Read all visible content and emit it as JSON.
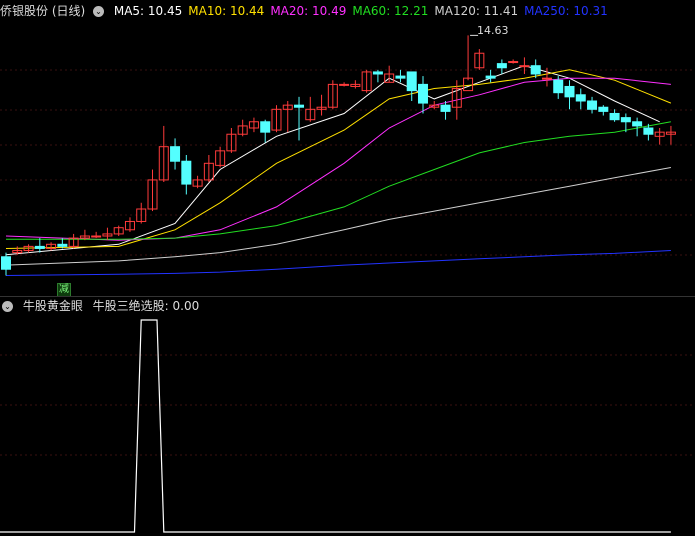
{
  "main": {
    "title": "侨银股份 (日线)",
    "ma_labels": [
      {
        "text": "MA5: 10.45",
        "color": "#ffffff"
      },
      {
        "text": "MA10: 10.44",
        "color": "#ffe000"
      },
      {
        "text": "MA20: 10.49",
        "color": "#ff30ff"
      },
      {
        "text": "MA60: 12.21",
        "color": "#22dd22"
      },
      {
        "text": "MA120: 11.41",
        "color": "#cfcfcf"
      },
      {
        "text": "MA250: 10.31",
        "color": "#2233ff"
      }
    ],
    "high_label": "14.63",
    "badge": "减"
  },
  "sub": {
    "title": "牛股黄金眼",
    "value_label": "牛股三绝选股: 0.00"
  },
  "colors": {
    "up": "#ff3b3b",
    "down": "#54ffff",
    "bg": "#000000",
    "grid": "#3a1010"
  },
  "chart_data": {
    "type": "candlestick",
    "ylim": [
      8.5,
      15.0
    ],
    "candles": [
      [
        9.3,
        9.4,
        9.0,
        8.85
      ],
      [
        9.4,
        9.55,
        9.45,
        9.35
      ],
      [
        9.45,
        9.6,
        9.55,
        9.4
      ],
      [
        9.55,
        9.75,
        9.5,
        9.4
      ],
      [
        9.5,
        9.65,
        9.6,
        9.45
      ],
      [
        9.6,
        9.75,
        9.55,
        9.5
      ],
      [
        9.55,
        9.85,
        9.75,
        9.5
      ],
      [
        9.75,
        9.95,
        9.8,
        9.7
      ],
      [
        9.8,
        9.9,
        9.8,
        9.75
      ],
      [
        9.8,
        10.0,
        9.85,
        9.7
      ],
      [
        9.85,
        10.05,
        10.0,
        9.8
      ],
      [
        9.95,
        10.25,
        10.15,
        9.9
      ],
      [
        10.15,
        10.6,
        10.45,
        10.1
      ],
      [
        10.45,
        11.4,
        11.15,
        10.4
      ],
      [
        11.15,
        12.45,
        11.95,
        11.1
      ],
      [
        11.95,
        12.15,
        11.6,
        11.4
      ],
      [
        11.6,
        11.75,
        11.05,
        10.8
      ],
      [
        11.0,
        11.25,
        11.15,
        10.95
      ],
      [
        11.15,
        11.75,
        11.55,
        11.1
      ],
      [
        11.5,
        11.95,
        11.85,
        11.45
      ],
      [
        11.85,
        12.4,
        12.25,
        11.8
      ],
      [
        12.25,
        12.6,
        12.45,
        12.2
      ],
      [
        12.4,
        12.65,
        12.55,
        12.3
      ],
      [
        12.55,
        12.6,
        12.3,
        12.05
      ],
      [
        12.35,
        12.95,
        12.85,
        12.3
      ],
      [
        12.85,
        13.05,
        12.95,
        12.3
      ],
      [
        12.95,
        13.15,
        12.9,
        12.1
      ],
      [
        12.6,
        13.15,
        12.85,
        12.55
      ],
      [
        12.85,
        13.2,
        12.9,
        12.7
      ],
      [
        12.9,
        13.55,
        13.45,
        12.85
      ],
      [
        13.45,
        13.5,
        13.45,
        13.4
      ],
      [
        13.4,
        13.55,
        13.45,
        13.35
      ],
      [
        13.3,
        13.8,
        13.75,
        13.25
      ],
      [
        13.75,
        13.8,
        13.7,
        13.5
      ],
      [
        13.5,
        13.9,
        13.7,
        13.5
      ],
      [
        13.65,
        13.8,
        13.6,
        13.5
      ],
      [
        13.75,
        13.75,
        13.3,
        13.05
      ],
      [
        13.45,
        13.65,
        13.0,
        12.75
      ],
      [
        12.9,
        13.05,
        12.95,
        12.85
      ],
      [
        12.95,
        13.05,
        12.8,
        12.6
      ],
      [
        12.9,
        13.55,
        13.35,
        12.6
      ],
      [
        13.3,
        14.63,
        13.6,
        13.55
      ],
      [
        13.85,
        14.3,
        14.2,
        13.8
      ],
      [
        13.65,
        13.8,
        13.6,
        13.5
      ],
      [
        13.95,
        14.05,
        13.85,
        13.7
      ],
      [
        14.0,
        14.05,
        14.0,
        13.95
      ],
      [
        13.9,
        14.1,
        13.9,
        13.7
      ],
      [
        13.9,
        14.05,
        13.7,
        13.6
      ],
      [
        13.6,
        13.85,
        13.6,
        13.4
      ],
      [
        13.55,
        13.65,
        13.25,
        13.1
      ],
      [
        13.4,
        13.55,
        13.15,
        12.85
      ],
      [
        13.2,
        13.35,
        13.05,
        12.85
      ],
      [
        13.05,
        13.15,
        12.85,
        12.75
      ],
      [
        12.9,
        12.95,
        12.8,
        12.7
      ],
      [
        12.75,
        12.85,
        12.6,
        12.55
      ],
      [
        12.65,
        12.75,
        12.55,
        12.3
      ],
      [
        12.55,
        12.65,
        12.45,
        12.2
      ],
      [
        12.4,
        12.5,
        12.25,
        12.1
      ],
      [
        12.2,
        12.4,
        12.3,
        12.0
      ],
      [
        12.25,
        12.45,
        12.3,
        12.0
      ]
    ],
    "ma_series": [
      {
        "name": "MA5",
        "values": [
          [
            0,
            9.35
          ],
          [
            10,
            9.6
          ],
          [
            15,
            10.1
          ],
          [
            19,
            11.4
          ],
          [
            24,
            12.2
          ],
          [
            30,
            12.75
          ],
          [
            34,
            13.6
          ],
          [
            38,
            13.1
          ],
          [
            42,
            13.5
          ],
          [
            46,
            13.9
          ],
          [
            50,
            13.6
          ],
          [
            54,
            13.05
          ],
          [
            58,
            12.55
          ]
        ]
      },
      {
        "name": "MA10",
        "values": [
          [
            0,
            9.5
          ],
          [
            10,
            9.55
          ],
          [
            15,
            9.95
          ],
          [
            19,
            10.6
          ],
          [
            24,
            11.55
          ],
          [
            30,
            12.35
          ],
          [
            34,
            13.1
          ],
          [
            38,
            13.35
          ],
          [
            42,
            13.45
          ],
          [
            46,
            13.6
          ],
          [
            50,
            13.8
          ],
          [
            54,
            13.55
          ],
          [
            59,
            13.0
          ]
        ]
      },
      {
        "name": "MA20",
        "values": [
          [
            0,
            9.8
          ],
          [
            10,
            9.7
          ],
          [
            15,
            9.75
          ],
          [
            19,
            9.95
          ],
          [
            24,
            10.5
          ],
          [
            30,
            11.55
          ],
          [
            34,
            12.4
          ],
          [
            38,
            12.95
          ],
          [
            42,
            13.2
          ],
          [
            46,
            13.5
          ],
          [
            50,
            13.6
          ],
          [
            54,
            13.6
          ],
          [
            59,
            13.45
          ]
        ]
      },
      {
        "name": "MA60",
        "values": [
          [
            0,
            9.72
          ],
          [
            10,
            9.72
          ],
          [
            15,
            9.75
          ],
          [
            19,
            9.85
          ],
          [
            24,
            10.05
          ],
          [
            30,
            10.5
          ],
          [
            34,
            11.0
          ],
          [
            38,
            11.4
          ],
          [
            42,
            11.8
          ],
          [
            46,
            12.05
          ],
          [
            50,
            12.2
          ],
          [
            54,
            12.3
          ],
          [
            59,
            12.55
          ]
        ]
      },
      {
        "name": "MA120",
        "values": [
          [
            0,
            9.1
          ],
          [
            10,
            9.2
          ],
          [
            15,
            9.3
          ],
          [
            19,
            9.4
          ],
          [
            24,
            9.6
          ],
          [
            30,
            9.95
          ],
          [
            34,
            10.2
          ],
          [
            38,
            10.4
          ],
          [
            42,
            10.6
          ],
          [
            46,
            10.8
          ],
          [
            50,
            11.0
          ],
          [
            54,
            11.2
          ],
          [
            59,
            11.45
          ]
        ]
      },
      {
        "name": "MA250",
        "values": [
          [
            0,
            8.85
          ],
          [
            10,
            8.88
          ],
          [
            15,
            8.9
          ],
          [
            19,
            8.93
          ],
          [
            24,
            9.0
          ],
          [
            30,
            9.1
          ],
          [
            34,
            9.15
          ],
          [
            38,
            9.2
          ],
          [
            42,
            9.25
          ],
          [
            46,
            9.3
          ],
          [
            50,
            9.35
          ],
          [
            54,
            9.38
          ],
          [
            59,
            9.45
          ]
        ]
      }
    ],
    "indicator": {
      "name": "牛股三绝选股",
      "ylim": [
        0,
        1
      ],
      "values": [
        0,
        0,
        0,
        0,
        0,
        0,
        0,
        0,
        0,
        0,
        0,
        0,
        1,
        1,
        0,
        0,
        0,
        0,
        0,
        0,
        0,
        0,
        0,
        0,
        0,
        0,
        0,
        0,
        0,
        0,
        0,
        0,
        0,
        0,
        0,
        0,
        0,
        0,
        0,
        0,
        0,
        0,
        0,
        0,
        0,
        0,
        0,
        0,
        0,
        0,
        0,
        0,
        0,
        0,
        0,
        0,
        0,
        0,
        0,
        0
      ]
    }
  }
}
